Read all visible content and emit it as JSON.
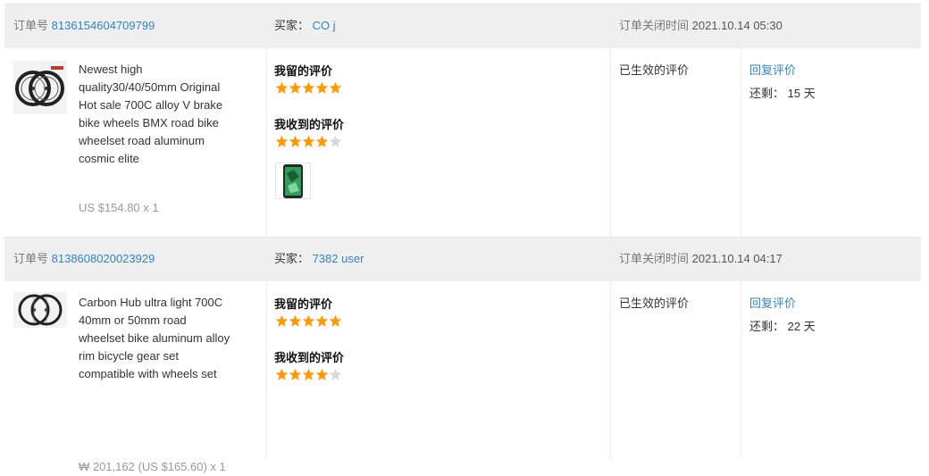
{
  "labels": {
    "order_no": "订单号",
    "buyer": "买家：",
    "close_time": "订单关闭时间",
    "my_review": "我留的评价",
    "received_review": "我收到的评价",
    "effective": "已生效的评价",
    "reply": "回复评价",
    "remaining": "还剩：",
    "days": "天"
  },
  "colors": {
    "star_on": "#ff9900",
    "star_off": "#d9d9d9",
    "link": "#2e86c1"
  },
  "orders": [
    {
      "number": "8136154604709799",
      "buyer": "CO j",
      "close_time": "2021.10.14 05:30",
      "product_name": "Newest high quality30/40/50mm Original Hot sale 700C alloy V brake bike wheels BMX road bike wheelset road aluminum cosmic elite",
      "price": "US $154.80 x 1",
      "my_rating": 5,
      "received_rating": 4,
      "has_attachment": true,
      "remaining_days": "15"
    },
    {
      "number": "8138608020023929",
      "buyer": "7382 user",
      "close_time": "2021.10.14 04:17",
      "product_name": "Carbon Hub ultra light 700C 40mm or 50mm road wheelset bike aluminum alloy rim bicycle gear set compatible with wheels set",
      "price": "₩ 201,162 (US $165.60) x 1",
      "my_rating": 5,
      "received_rating": 4,
      "has_attachment": false,
      "remaining_days": "22"
    }
  ]
}
